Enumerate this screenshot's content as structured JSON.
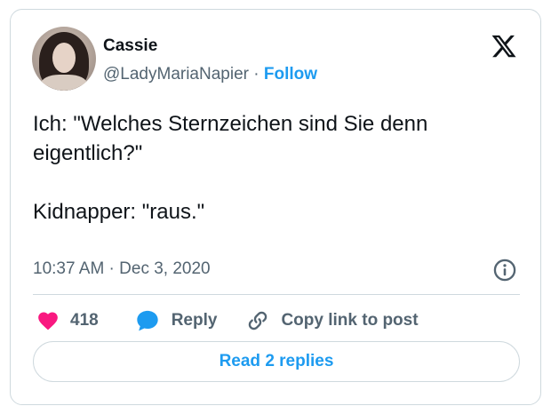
{
  "author": {
    "name": "Cassie",
    "handle": "@LadyMariaNapier",
    "separator": " · ",
    "follow_label": "Follow"
  },
  "tweet": {
    "text": "Ich: \"Welches Sternzeichen sind Sie denn eigentlich?\"\n\nKidnapper: \"raus.\"",
    "timestamp": "10:37 AM · Dec 3, 2020"
  },
  "actions": {
    "likes_count": "418",
    "reply_label": "Reply",
    "copy_link_label": "Copy link to post"
  },
  "read_replies_label": "Read 2 replies",
  "colors": {
    "accent": "#1d9bf0",
    "like": "#f91880",
    "text": "#0f1419",
    "muted": "#536471",
    "border": "#cfd9de"
  },
  "icons": [
    "x-logo-icon",
    "info-icon",
    "heart-icon",
    "reply-bubble-icon",
    "link-icon"
  ]
}
